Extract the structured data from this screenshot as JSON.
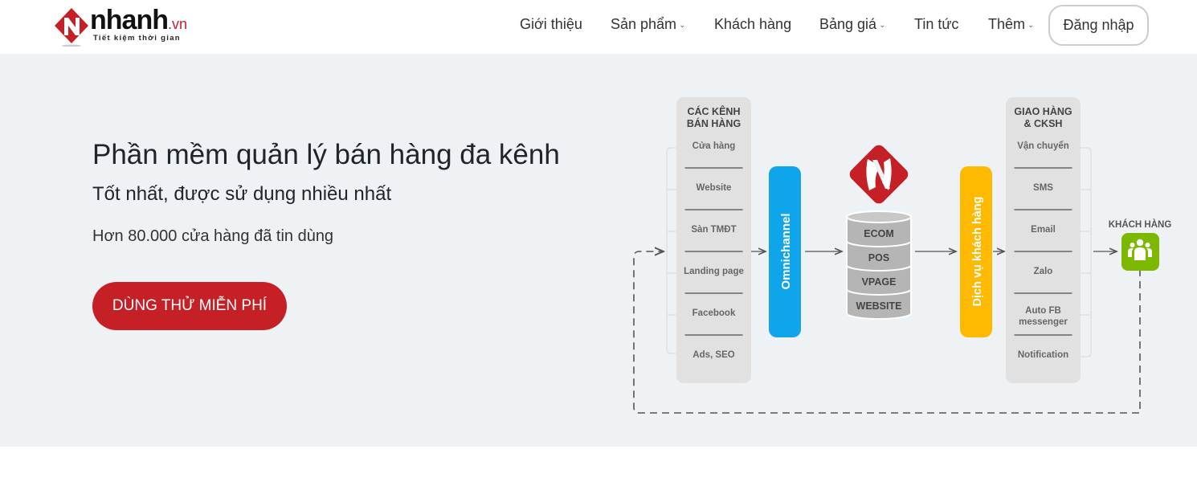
{
  "header": {
    "logo": {
      "name": "nhanh",
      "suffix": ".vn",
      "tagline": "Tiết kiệm thời gian",
      "brand_color": "#c62027"
    },
    "nav": [
      {
        "label": "Giới thiệu",
        "has_dropdown": false
      },
      {
        "label": "Sản phẩm",
        "has_dropdown": true
      },
      {
        "label": "Khách hàng",
        "has_dropdown": false
      },
      {
        "label": "Bảng giá",
        "has_dropdown": true
      },
      {
        "label": "Tin tức",
        "has_dropdown": false
      },
      {
        "label": "Thêm",
        "has_dropdown": true
      }
    ],
    "chevron": "⌄",
    "login_label": "Đăng nhập"
  },
  "hero": {
    "title": "Phần mềm quản lý bán hàng đa kênh",
    "subtitle": "Tốt nhất, được sử dụng nhiều nhất",
    "note": "Hơn 80.000 cửa hàng đã tin dùng",
    "cta_label": "DÙNG THỬ MIỄN PHÍ",
    "cta_color": "#c62027",
    "background": "#eef2f5"
  },
  "diagram": {
    "sales_channels": {
      "heading_line1": "CÁC KÊNH",
      "heading_line2": "BÁN HÀNG",
      "items": [
        "Cửa hàng",
        "Website",
        "Sàn TMĐT",
        "Landing page",
        "Facebook",
        "Ads, SEO"
      ]
    },
    "omnichannel": {
      "label": "Omnichannel",
      "color": "#0ea5ea"
    },
    "database": {
      "layers": [
        "ECOM",
        "POS",
        "VPAGE",
        "WEBSITE"
      ]
    },
    "customer_service": {
      "label": "Dịch vụ khách hàng",
      "color": "#ffb901"
    },
    "delivery": {
      "heading_line1": "GIAO HÀNG",
      "heading_line2": "& CKSH",
      "items": [
        "Vận chuyển",
        "SMS",
        "Email",
        "Zalo",
        "Auto FB|messenger",
        "Notification"
      ]
    },
    "customer": {
      "label": "KHÁCH HÀNG",
      "color": "#7cb800",
      "icon": "users-icon"
    }
  }
}
